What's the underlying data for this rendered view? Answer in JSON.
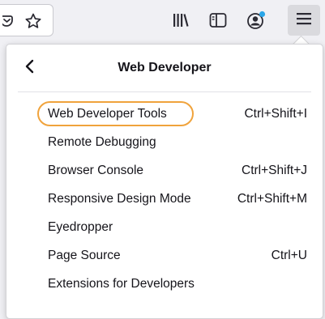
{
  "toolbar": {
    "icons": {
      "pocket": "pocket-icon",
      "bookmark": "star-icon",
      "library": "library-icon",
      "sidebar": "sidebar-icon",
      "account": "account-icon",
      "menu": "hamburger-menu-icon"
    },
    "account_badge_color": "#2ba6e8"
  },
  "panel": {
    "title": "Web Developer",
    "back_icon": "chevron-left-icon",
    "items": [
      {
        "label": "Web Developer Tools",
        "shortcut": "Ctrl+Shift+I",
        "highlighted": true
      },
      {
        "label": "Remote Debugging",
        "shortcut": ""
      },
      {
        "label": "Browser Console",
        "shortcut": "Ctrl+Shift+J"
      },
      {
        "label": "Responsive Design Mode",
        "shortcut": "Ctrl+Shift+M"
      },
      {
        "label": "Eyedropper",
        "shortcut": ""
      },
      {
        "label": "Page Source",
        "shortcut": "Ctrl+U"
      },
      {
        "label": "Extensions for Developers",
        "shortcut": ""
      }
    ],
    "highlight_color": "#f0a33c"
  }
}
